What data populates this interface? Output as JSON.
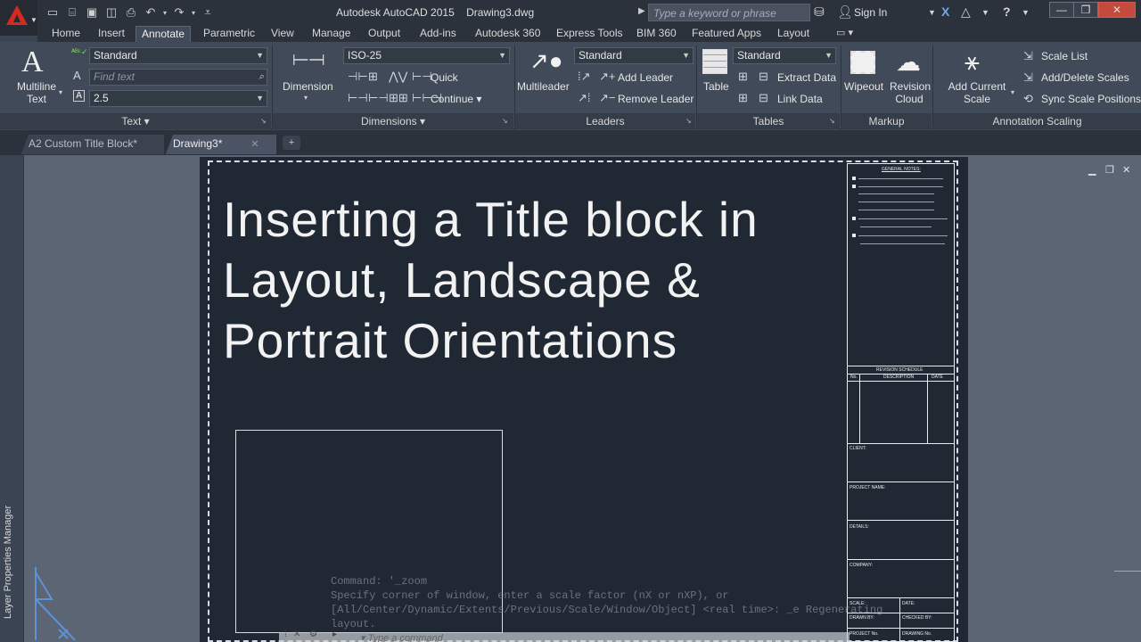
{
  "titlebar": {
    "app_name": "Autodesk AutoCAD 2015",
    "document": "Drawing3.dwg",
    "search_placeholder": "Type a keyword or phrase",
    "signin": "Sign In"
  },
  "ribbon_tabs": [
    "Home",
    "Insert",
    "Annotate",
    "Parametric",
    "View",
    "Manage",
    "Output",
    "Add-ins",
    "Autodesk 360",
    "Express Tools",
    "BIM 360",
    "Featured Apps",
    "Layout"
  ],
  "active_tab": "Annotate",
  "ribbon": {
    "text_panel": {
      "title": "Text",
      "multiline_text": "Multiline Text",
      "style_combo": "Standard",
      "find_placeholder": "Find text",
      "height_combo": "2.5"
    },
    "dimensions_panel": {
      "title": "Dimensions",
      "dimension": "Dimension",
      "style_combo": "ISO-25",
      "quick": "Quick",
      "continue": "Continue"
    },
    "leaders_panel": {
      "title": "Leaders",
      "multileader": "Multileader",
      "style_combo": "Standard",
      "add_leader": "Add Leader",
      "remove_leader": "Remove Leader"
    },
    "tables_panel": {
      "title": "Tables",
      "table": "Table",
      "style_combo": "Standard",
      "extract_data": "Extract Data",
      "link_data": "Link Data"
    },
    "markup_panel": {
      "title": "Markup",
      "wipeout": "Wipeout",
      "revision_cloud": "Revision Cloud"
    },
    "annotation_scaling_panel": {
      "title": "Annotation Scaling",
      "add_current_scale": "Add Current Scale",
      "scale_list": "Scale List",
      "add_delete_scales": "Add/Delete Scales",
      "sync_scale_positions": "Sync Scale Positions"
    }
  },
  "doc_tabs": [
    {
      "label": "A2 Custom Title Block*",
      "active": false
    },
    {
      "label": "Drawing3*",
      "active": true
    }
  ],
  "palette": {
    "layer_properties_manager": "Layer Properties Manager"
  },
  "drawing": {
    "heading_lines": [
      "Inserting a Title block in",
      "Layout, Landscape &",
      "Portrait Orientations"
    ]
  },
  "titleblock": {
    "general_notes": "GENERAL NOTES:",
    "revision_schedule": "REVISION SCHEDULE",
    "col_no": "No.",
    "col_description": "DESCRIPTION",
    "col_date": "DATE",
    "client": "CLIENT:",
    "project_name": "PROJECT NAME:",
    "details": "DETAILS:",
    "company": "COMPANY:",
    "scale": "SCALE:",
    "date": "DATE:",
    "drawn_by": "DRAWN BY:",
    "checked_by": "CHECKED BY:",
    "project_no": "PROJECT No.",
    "drawing_no": "DRAWING No."
  },
  "command": {
    "history": [
      "Command: '_zoom",
      "Specify corner of window, enter a scale factor (nX or nXP), or",
      "[All/Center/Dynamic/Extents/Previous/Scale/Window/Object] <real time>: _e Regenerating",
      "layout."
    ],
    "input_placeholder": "Type a command"
  },
  "colors": {
    "accent": "#d52a1e",
    "ribbon_bg": "#404a58",
    "sheet_bg": "#202833",
    "canvas_bg": "#5b6574"
  }
}
